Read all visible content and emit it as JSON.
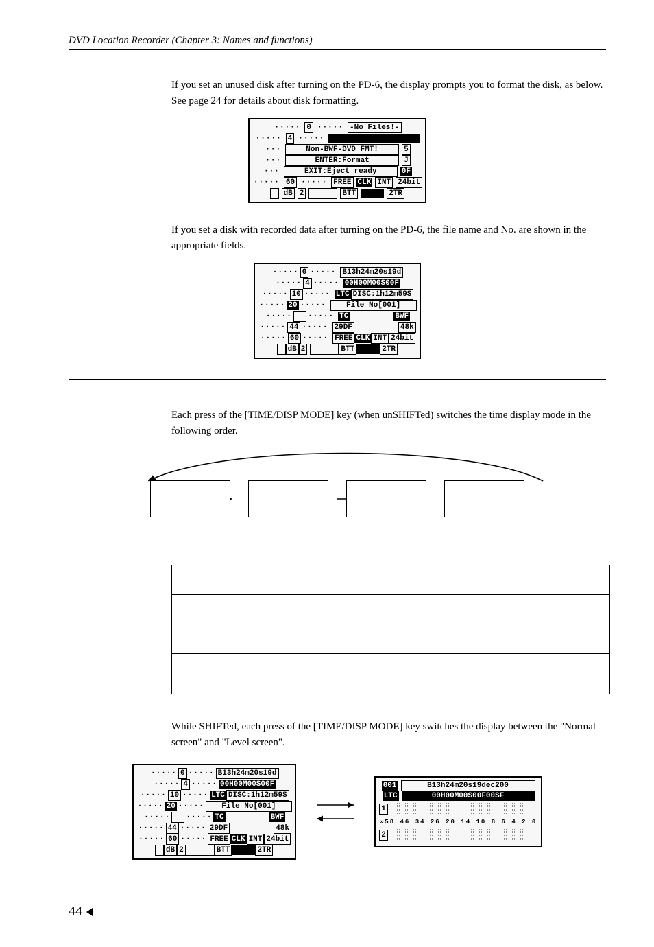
{
  "header": "DVD Location Recorder (Chapter 3: Names and functions)",
  "para1": "If you set an unused disk after turning on the PD-6, the display prompts you to format the disk, as below. See page 24 for details about disk formatting.",
  "para2": "If you set a disk with recorded data after turning on the PD-6, the file name and No. are shown in the appropriate fields.",
  "para3": "Each press of the [TIME/DISP MODE] key (when unSHIFTed) switches the time display mode in the following order.",
  "para4": "While SHIFTed, each press of the [TIME/DISP MODE] key switches the display between the \"Normal screen\" and \"Level screen\".",
  "page_number": "44",
  "lcd1": {
    "r0a": "0",
    "r0b": "-No Files!-",
    "r1a": "4",
    "m1": "Non-BWF-DVD FMT!",
    "m1r": "5",
    "m2": "ENTER:Format",
    "m2r": "J",
    "m3": "EXIT:Eject ready",
    "m3r": "0F",
    "b_lbl": "60",
    "b_free": "FREE",
    "b_clk": "CLK",
    "b_int": "INT",
    "b_bit": "24bit",
    "f_lbl": "dB",
    "f_num": "2",
    "f_btt": "BTT",
    "f_tr": "2TR"
  },
  "lcd2": {
    "r0a": "0",
    "r0b": "B13h24m20s19d",
    "r1a": "4",
    "r1b": "00H00M00S00F",
    "r2a": "10",
    "r2b": "LTC",
    "r2c": "DISC:1h12m59S",
    "r3a": "20",
    "r3b": "File No[001]",
    "r4a": "44",
    "r4b": "TC",
    "r4c": "BWF",
    "r5a": "",
    "r5b": "29DF",
    "r5c": "48k",
    "r6a": "60",
    "r6b": "FREE",
    "r6c": "CLK",
    "r6d": "INT",
    "r6e": "24bit",
    "f_lbl": "dB",
    "f_num": "2",
    "f_btt": "BTT",
    "f_tr": "2TR"
  },
  "lcd_level": {
    "r0a": "001",
    "r0b": "B13h24m20s19dec200",
    "r1a": "LTC",
    "r1b": "00H00M00S00F00SF",
    "ch1": "1",
    "ch2": "2",
    "scale": "∞58 46 34 26 20  14 10  8  6  4  2  0"
  }
}
